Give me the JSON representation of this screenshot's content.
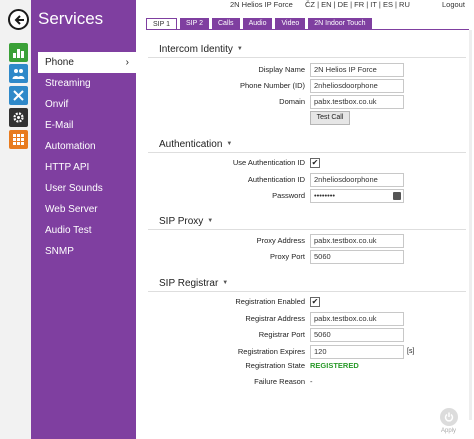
{
  "device_name": "2N Helios IP Force",
  "languages": "ČZ | EN | DE | FR | IT | ES | RU",
  "logout_label": "Logout",
  "sidebar": {
    "title": "Services",
    "items": [
      {
        "label": "Phone",
        "active": true
      },
      {
        "label": "Streaming"
      },
      {
        "label": "Onvif"
      },
      {
        "label": "E-Mail"
      },
      {
        "label": "Automation"
      },
      {
        "label": "HTTP API"
      },
      {
        "label": "User Sounds"
      },
      {
        "label": "Web Server"
      },
      {
        "label": "Audio Test"
      },
      {
        "label": "SNMP"
      }
    ],
    "chevron": "›"
  },
  "rail": {
    "icons": [
      "back-arrow-icon",
      "bar-chart-icon",
      "users-icon",
      "tools-icon",
      "gear-icon",
      "grid-icon"
    ],
    "colors": {
      "green": "#3aa037",
      "blue": "#2f89c9",
      "orange": "#e87b1e",
      "dark": "#333333"
    }
  },
  "tabs": [
    "SIP 1",
    "SIP 2",
    "Calls",
    "Audio",
    "Video",
    "2N Indoor Touch"
  ],
  "sections": {
    "intercom": {
      "title": "Intercom Identity",
      "display_name_label": "Display Name",
      "display_name_value": "2N Helios IP Force",
      "phone_label": "Phone Number (ID)",
      "phone_value": "2nheliosdoorphone",
      "domain_label": "Domain",
      "domain_value": "pabx.testbox.co.uk",
      "test_call_label": "Test Call"
    },
    "authentication": {
      "title": "Authentication",
      "use_auth_label": "Use Authentication ID",
      "use_auth_checked": true,
      "auth_id_label": "Authentication ID",
      "auth_id_value": "2nheliosdoorphone",
      "password_label": "Password",
      "password_value": "••••••••"
    },
    "sip_proxy": {
      "title": "SIP Proxy",
      "proxy_address_label": "Proxy Address",
      "proxy_address_value": "pabx.testbox.co.uk",
      "proxy_port_label": "Proxy Port",
      "proxy_port_value": "5060"
    },
    "sip_registrar": {
      "title": "SIP Registrar",
      "reg_enabled_label": "Registration Enabled",
      "reg_enabled_checked": true,
      "reg_address_label": "Registrar Address",
      "reg_address_value": "pabx.testbox.co.uk",
      "reg_port_label": "Registrar Port",
      "reg_port_value": "5060",
      "reg_expires_label": "Registration Expires",
      "reg_expires_value": "120",
      "reg_expires_unit": "[s]",
      "reg_state_label": "Registration State",
      "reg_state_value": "REGISTERED",
      "failure_label": "Failure Reason",
      "failure_value": "-"
    }
  },
  "caret": "▼",
  "checkmark": "✔",
  "apply_label": "Apply",
  "colors": {
    "accent": "#7f3fa0",
    "registered": "#2a9a2a"
  }
}
